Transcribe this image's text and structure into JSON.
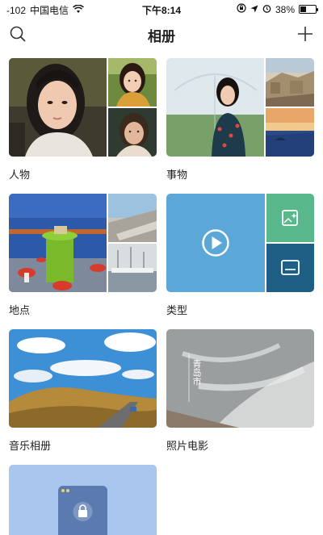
{
  "status_bar": {
    "signal": "-102",
    "carrier": "中国电信",
    "time": "下午8:14",
    "battery": "38%",
    "battery_level": 0.38
  },
  "header": {
    "title": "相册",
    "search_icon": "search-icon",
    "add_icon": "plus-icon"
  },
  "albums": [
    {
      "label": "人物"
    },
    {
      "label": "事物"
    },
    {
      "label": "地点"
    },
    {
      "label": "类型"
    },
    {
      "label": "音乐相册"
    },
    {
      "label": "照片电影",
      "overlay_text": "青岛市"
    }
  ],
  "colors": {
    "type_main": "#5aa7d8",
    "type_top": "#58b88c",
    "type_bottom": "#1f5f86",
    "private_bg": "#a9c6ee"
  }
}
